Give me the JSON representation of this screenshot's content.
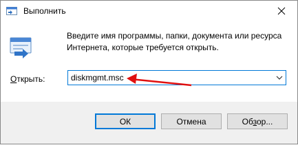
{
  "window": {
    "title": "Выполнить",
    "close_label": "Close"
  },
  "dialog": {
    "description_line1": "Введите имя программы, папки, документа или ресурса",
    "description_line2": "Интернета, которые требуется открыть.",
    "open_label_prefix": "",
    "open_label_mnemonic": "О",
    "open_label_rest": "ткрыть:",
    "command_value": "diskmgmt.msc"
  },
  "buttons": {
    "ok": "ОК",
    "cancel": "Отмена",
    "browse_prefix": "Об",
    "browse_mnemonic": "з",
    "browse_rest": "ор..."
  },
  "annotation": {
    "arrow_color": "#e01010"
  },
  "colors": {
    "focus_border": "#0078d7",
    "footer_bg": "#f0f0f0"
  }
}
